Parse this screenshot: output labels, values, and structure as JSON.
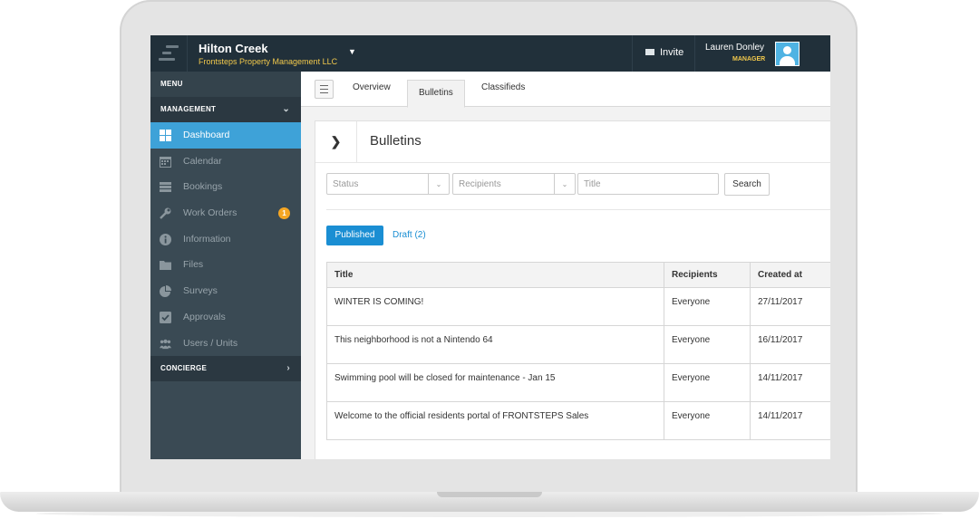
{
  "topbar": {
    "community_name": "Hilton Creek",
    "company_name": "Frontsteps Property Management LLC",
    "invite_label": "Invite",
    "user_name": "Lauren Donley",
    "user_role": "MANAGER"
  },
  "sidebar": {
    "menu_label": "MENU",
    "management_label": "MANAGEMENT",
    "items": [
      {
        "label": "Dashboard",
        "icon": "dashboard-icon",
        "active": true
      },
      {
        "label": "Calendar",
        "icon": "calendar-icon"
      },
      {
        "label": "Bookings",
        "icon": "bookings-icon"
      },
      {
        "label": "Work Orders",
        "icon": "wrench-icon",
        "badge": "1"
      },
      {
        "label": "Information",
        "icon": "info-icon"
      },
      {
        "label": "Files",
        "icon": "folder-icon"
      },
      {
        "label": "Surveys",
        "icon": "pie-chart-icon"
      },
      {
        "label": "Approvals",
        "icon": "checkbox-icon"
      },
      {
        "label": "Users / Units",
        "icon": "users-icon"
      }
    ],
    "concierge_label": "CONCIERGE"
  },
  "tabs": {
    "overview": "Overview",
    "bulletins": "Bulletins",
    "classifieds": "Classifieds"
  },
  "card": {
    "title": "Bulletins"
  },
  "filters": {
    "status_placeholder": "Status",
    "recipients_placeholder": "Recipients",
    "title_placeholder": "Title",
    "search_label": "Search"
  },
  "pills": {
    "published": "Published",
    "draft": "Draft (2)"
  },
  "table": {
    "headers": [
      "Title",
      "Recipients",
      "Created at"
    ],
    "rows": [
      [
        "WINTER IS COMING!",
        "Everyone",
        "27/11/2017"
      ],
      [
        "This neighborhood is not a Nintendo 64",
        "Everyone",
        "16/11/2017"
      ],
      [
        "Swimming pool will be closed for maintenance - Jan 15",
        "Everyone",
        "14/11/2017"
      ],
      [
        "Welcome to the official residents portal of FRONTSTEPS Sales",
        "Everyone",
        "14/11/2017"
      ]
    ]
  },
  "colors": {
    "topbar_bg": "#21303a",
    "sidebar_bg": "#3a4a54",
    "active_blue": "#3ea2d8",
    "accent_yellow": "#f2c94c",
    "badge_orange": "#f5a623",
    "link_blue": "#1a8ed3"
  }
}
